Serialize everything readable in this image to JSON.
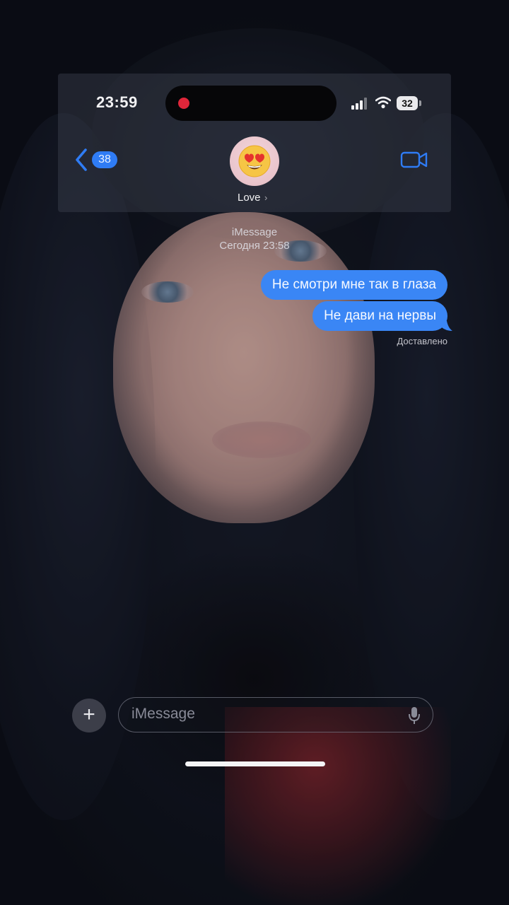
{
  "status_bar": {
    "time": "23:59",
    "battery": "32",
    "icons": [
      "recording-dot-icon",
      "signal-icon",
      "wifi-icon",
      "battery-icon"
    ]
  },
  "header": {
    "back_count": "38",
    "contact_name": "Love",
    "avatar_emoji": "heart-eyes-emoji",
    "contact_chevron": "›",
    "video_icon": "video-camera-icon"
  },
  "thread": {
    "service": "iMessage",
    "timestamp": "Сегодня 23:58",
    "messages": [
      {
        "text": "Не смотри мне так в глаза",
        "sender": "me"
      },
      {
        "text": "Не дави на нервы",
        "sender": "me"
      }
    ],
    "delivery_status": "Доставлено"
  },
  "composer": {
    "placeholder": "iMessage",
    "plus_label": "+",
    "mic_icon": "microphone-icon"
  },
  "colors": {
    "bubble": "#3a86f5",
    "accent": "#2f7cf5",
    "recording": "#e0263a"
  }
}
